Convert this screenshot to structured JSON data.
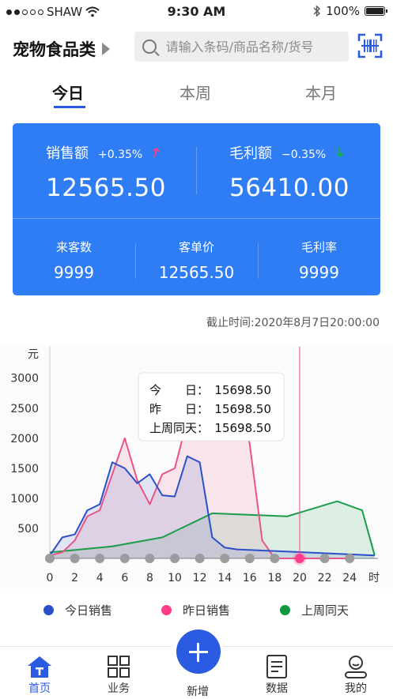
{
  "status_bar": {
    "carrier": "SHAW",
    "time": "9:30 AM",
    "battery": "100%"
  },
  "header": {
    "category": "宠物食品类",
    "search_placeholder": "请输入条码/商品名称/货号"
  },
  "tabs": [
    {
      "label": "今日",
      "active": true
    },
    {
      "label": "本周",
      "active": false
    },
    {
      "label": "本月",
      "active": false
    }
  ],
  "summary": {
    "sales": {
      "label": "销售额",
      "change": "+0.35%",
      "value": "12565.50",
      "trend": "up"
    },
    "gross_profit": {
      "label": "毛利额",
      "change": "−0.35%",
      "value": "56410.00",
      "trend": "down"
    },
    "metrics": [
      {
        "label": "来客数",
        "value": "9999"
      },
      {
        "label": "客单价",
        "value": "12565.50"
      },
      {
        "label": "毛利率",
        "value": "9999"
      }
    ]
  },
  "cutoff_time": "截止时间:2020年8月7日20:00:00",
  "colors": {
    "accent": "#2b5be0",
    "card": "#2f7df5",
    "up": "#ff3d8b",
    "down": "#12b04a"
  },
  "chart_data": {
    "type": "area",
    "ylabel": "元",
    "xlabel": "时",
    "ylim": [
      0,
      3500
    ],
    "yticks": [
      500,
      1000,
      1500,
      2000,
      2500,
      3000
    ],
    "xlim": [
      0,
      26
    ],
    "xticks": [
      0,
      2,
      4,
      6,
      8,
      10,
      12,
      14,
      16,
      18,
      20,
      22,
      24
    ],
    "series": [
      {
        "name": "今日销售",
        "color": "#2b4fc9",
        "x": [
          0,
          1,
          2,
          3,
          4,
          5,
          6,
          7,
          8,
          9,
          10,
          11,
          12,
          13,
          14,
          15,
          26
        ],
        "y": [
          50,
          350,
          400,
          800,
          900,
          1600,
          1500,
          1250,
          1400,
          1050,
          1030,
          1700,
          1600,
          350,
          180,
          150,
          50
        ]
      },
      {
        "name": "昨日销售",
        "color": "#e85586",
        "x": [
          0,
          1,
          2,
          3,
          4,
          5,
          6,
          7,
          8,
          9,
          10,
          11,
          12,
          13,
          14,
          15,
          16,
          17,
          18,
          19,
          20,
          21,
          22,
          23,
          24
        ],
        "y": [
          50,
          100,
          300,
          700,
          800,
          1400,
          2000,
          1300,
          900,
          1400,
          1500,
          2300,
          2000,
          2800,
          2700,
          3080,
          1900,
          300,
          0,
          0,
          0,
          0,
          0,
          0,
          0
        ]
      },
      {
        "name": "上周同天",
        "color": "#1a9c4a",
        "x": [
          0,
          5,
          9,
          13,
          19,
          23,
          25,
          26
        ],
        "y": [
          100,
          200,
          350,
          750,
          700,
          950,
          800,
          50
        ]
      }
    ],
    "tooltip": {
      "rows": [
        {
          "label": "今　　日：",
          "value": "15698.50"
        },
        {
          "label": "昨　　日：",
          "value": "15698.50"
        },
        {
          "label": "上周同天：",
          "value": "15698.50"
        }
      ]
    },
    "highlight_x": 20
  },
  "legend": [
    {
      "label": "今日销售",
      "color": "#2b4fc9"
    },
    {
      "label": "昨日销售",
      "color": "#ff3d8b"
    },
    {
      "label": "上周同天",
      "color": "#12963f"
    }
  ],
  "tabbar": {
    "items": [
      {
        "label": "首页",
        "active": true
      },
      {
        "label": "业务",
        "active": false
      },
      {
        "label": "新增",
        "active": false
      },
      {
        "label": "数据",
        "active": false
      },
      {
        "label": "我的",
        "active": false
      }
    ]
  }
}
